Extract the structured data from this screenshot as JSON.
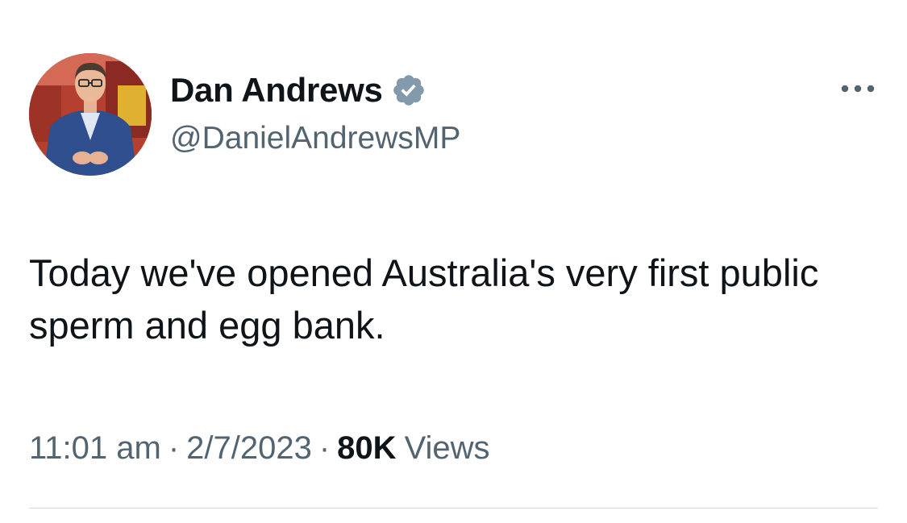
{
  "author": {
    "name": "Dan Andrews",
    "handle": "@DanielAndrewsMP",
    "verified_color": "#829aab"
  },
  "tweet": {
    "text": "Today we've opened Australia's very first public sperm and egg bank."
  },
  "meta": {
    "time": "11:01 am",
    "separator": "·",
    "date": "2/7/2023",
    "views_count": "80K",
    "views_label": "Views"
  },
  "icons": {
    "more": "more-horizontal-icon",
    "verified": "verified-badge-icon"
  }
}
